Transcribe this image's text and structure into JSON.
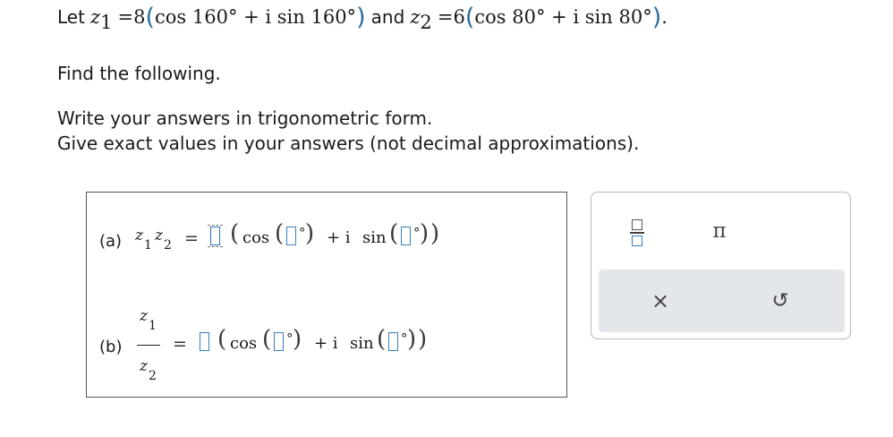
{
  "problem": {
    "let_word": "Let",
    "z1_var": "z",
    "z1_sub": "1",
    "z1_expr_lhs": "=8",
    "z1_expr_body": "cos 160° + i sin 160°",
    "and_word": "and",
    "z2_var": "z",
    "z2_sub": "2",
    "z2_expr_lhs": "=6",
    "z2_expr_body": "cos 80° + i sin 80°",
    "period": ".",
    "find_text": "Find the following.",
    "instruction1": "Write your answers in trigonometric form.",
    "instruction2": "Give exact values in your answers (not decimal approximations)."
  },
  "answers": {
    "a": {
      "label": "(a)",
      "z": "z",
      "sub1": "1",
      "sub2": "2",
      "eq": "=",
      "cos": "cos",
      "plus_i": "+ i",
      "sin": "sin",
      "deg": "°"
    },
    "b": {
      "label": "(b)",
      "z": "z",
      "sub1": "1",
      "sub2": "2",
      "eq": "=",
      "cos": "cos",
      "plus_i": "+ i",
      "sin": "sin",
      "deg": "°"
    }
  },
  "toolbar": {
    "pi_label": "π",
    "clear_label": "×",
    "undo_label": "↺",
    "icons": [
      "fraction-icon",
      "pi-icon",
      "close-icon",
      "undo-icon"
    ]
  },
  "colors": {
    "input_border": "#3a7fbf",
    "paren_blue": "#2a6e9e",
    "toolbar_grey": "#e3e6ea"
  }
}
